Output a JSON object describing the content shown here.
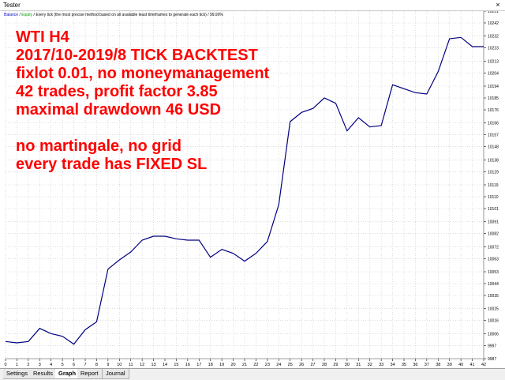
{
  "window": {
    "title": "Tester",
    "close_glyph": "×"
  },
  "legend": {
    "balance": "Balance",
    "equity": "Equity",
    "description": " / Every tick (the most precise method based on all available least timeframes to generate each tick) / 99.90%"
  },
  "overlay": {
    "lines": [
      "WTI H4",
      "2017/10-2019/8 TICK BACKTEST",
      "fixlot 0.01, no moneymanagement",
      "42 trades, profit factor 3.85",
      "maximal drawdown 46 USD",
      "",
      "no martingale, no grid",
      "every trade has FIXED SL"
    ],
    "color": "#ff0000"
  },
  "tabs": [
    "Settings",
    "Results",
    "Graph",
    "Report",
    "Journal"
  ],
  "active_tab": "Graph",
  "chart_data": {
    "type": "line",
    "x": [
      0,
      1,
      2,
      3,
      4,
      5,
      6,
      7,
      8,
      9,
      10,
      11,
      12,
      13,
      14,
      15,
      16,
      17,
      18,
      19,
      20,
      21,
      22,
      23,
      24,
      25,
      26,
      27,
      28,
      29,
      30,
      31,
      32,
      33,
      34,
      35,
      36,
      37,
      38,
      39,
      40,
      41,
      42
    ],
    "series": [
      {
        "values": [
          10000,
          9999,
          10000,
          10010,
          10006,
          10004,
          9998,
          10009,
          10015,
          10055,
          10062,
          10068,
          10077,
          10080,
          10080,
          10078,
          10077,
          10077,
          10064,
          10070,
          10067,
          10061,
          10067,
          10076,
          10104,
          10167,
          10174,
          10177,
          10185,
          10181,
          10160,
          10170,
          10163,
          10164,
          10195,
          10192,
          10189,
          10188,
          10205,
          10230,
          10231,
          10224,
          10224
        ],
        "color": "#000080"
      }
    ],
    "y_ticks": [
      9987,
      9997,
      10006,
      10016,
      10025,
      10035,
      10044,
      10053,
      10063,
      10072,
      10082,
      10091,
      10101,
      10110,
      10119,
      10129,
      10138,
      10148,
      10157,
      10166,
      10176,
      10185,
      10194,
      10204,
      10213,
      10223,
      10232,
      10242,
      10251
    ],
    "x_ticks": [
      "0",
      "1",
      "2",
      "3",
      "4",
      "5",
      "6",
      "7",
      "8",
      "9",
      "10",
      "11",
      "12",
      "13",
      "14",
      "15",
      "16",
      "17",
      "18",
      "19",
      "20",
      "21",
      "22",
      "23",
      "24",
      "25",
      "26",
      "27",
      "28",
      "29",
      "30",
      "31",
      "32",
      "33",
      "34",
      "35",
      "36",
      "37",
      "38",
      "39",
      "40",
      "41",
      "42"
    ],
    "ylim": [
      9987,
      10251
    ],
    "xlim": [
      0,
      42
    ],
    "grid": true,
    "background": "#ffffff",
    "grid_color": "#c8c8c8"
  }
}
